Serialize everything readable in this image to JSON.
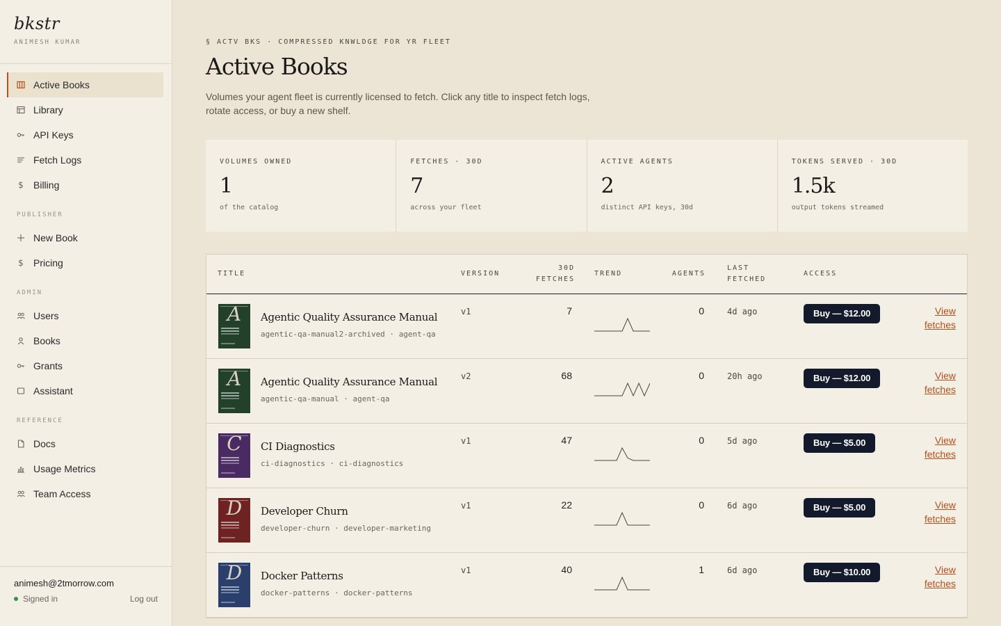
{
  "sidebar": {
    "brand": "bkstr",
    "user": "ANIMESH KUMAR",
    "main_items": [
      {
        "label": "Active Books",
        "icon": "columns-icon"
      },
      {
        "label": "Library",
        "icon": "library-icon"
      },
      {
        "label": "API Keys",
        "icon": "key-icon"
      },
      {
        "label": "Fetch Logs",
        "icon": "list-icon"
      },
      {
        "label": "Billing",
        "icon": "dollar-icon"
      }
    ],
    "publisher_label": "PUBLISHER",
    "publisher_items": [
      {
        "label": "New Book",
        "icon": "plus-icon"
      },
      {
        "label": "Pricing",
        "icon": "dollar-icon"
      }
    ],
    "admin_label": "ADMIN",
    "admin_items": [
      {
        "label": "Users",
        "icon": "users-icon"
      },
      {
        "label": "Books",
        "icon": "person-icon"
      },
      {
        "label": "Grants",
        "icon": "key-icon"
      },
      {
        "label": "Assistant",
        "icon": "square-icon"
      }
    ],
    "reference_label": "REFERENCE",
    "reference_items": [
      {
        "label": "Docs",
        "icon": "document-icon"
      },
      {
        "label": "Usage Metrics",
        "icon": "bar-chart-icon"
      },
      {
        "label": "Team Access",
        "icon": "users-icon"
      }
    ],
    "footer": {
      "email": "animesh@2tmorrow.com",
      "status": "Signed in",
      "logout": "Log out"
    }
  },
  "header": {
    "eyebrow": "§ ACTV BKS · COMPRESSED KNWLDGE FOR YR FLEET",
    "title": "Active Books",
    "description": "Volumes your agent fleet is currently licensed to fetch. Click any title to inspect fetch logs, rotate access, or buy a new shelf."
  },
  "stats": [
    {
      "label": "VOLUMES OWNED",
      "value": "1",
      "sub": "of the catalog"
    },
    {
      "label": "FETCHES · 30D",
      "value": "7",
      "sub": "across your fleet"
    },
    {
      "label": "ACTIVE AGENTS",
      "value": "2",
      "sub": "distinct API keys, 30d"
    },
    {
      "label": "TOKENS SERVED · 30D",
      "value": "1.5k",
      "sub": "output tokens streamed"
    }
  ],
  "table": {
    "columns": {
      "title": "TITLE",
      "version": "VERSION",
      "fetches_1": "30D",
      "fetches_2": "FETCHES",
      "trend": "TREND",
      "agents": "AGENTS",
      "last_1": "LAST",
      "last_2": "FETCHED",
      "access": "ACCESS"
    },
    "rows": [
      {
        "letter": "A",
        "cover_color": "#22402a",
        "title": "Agentic Quality Assurance Manual",
        "slug": "agentic-qa-manual2-archived",
        "tag": "agent-qa",
        "version": "v1",
        "fetches": "7",
        "agents": "0",
        "last": "4d ago",
        "buy": "Buy — $12.00",
        "view": "View fetches",
        "trend": [
          0,
          0,
          0,
          0,
          0,
          0,
          1,
          0,
          0,
          0,
          0
        ]
      },
      {
        "letter": "A",
        "cover_color": "#22402a",
        "title": "Agentic Quality Assurance Manual",
        "slug": "agentic-qa-manual",
        "tag": "agent-qa",
        "version": "v2",
        "fetches": "68",
        "agents": "0",
        "last": "20h ago",
        "buy": "Buy — $12.00",
        "view": "View fetches",
        "trend": [
          0,
          0,
          0,
          0,
          0,
          0,
          1,
          0,
          1,
          0,
          1
        ]
      },
      {
        "letter": "C",
        "cover_color": "#4a2a63",
        "title": "CI Diagnostics",
        "slug": "ci-diagnostics",
        "tag": "ci-diagnostics",
        "version": "v1",
        "fetches": "47",
        "agents": "0",
        "last": "5d ago",
        "buy": "Buy — $5.00",
        "view": "View fetches",
        "trend": [
          0,
          0,
          0,
          0,
          0,
          1,
          0.2,
          0,
          0,
          0,
          0
        ]
      },
      {
        "letter": "D",
        "cover_color": "#6e2222",
        "title": "Developer Churn",
        "slug": "developer-churn",
        "tag": "developer-marketing",
        "version": "v1",
        "fetches": "22",
        "agents": "0",
        "last": "6d ago",
        "buy": "Buy — $5.00",
        "view": "View fetches",
        "trend": [
          0,
          0,
          0,
          0,
          0,
          1,
          0,
          0,
          0,
          0,
          0
        ]
      },
      {
        "letter": "D",
        "cover_color": "#2b3f6d",
        "title": "Docker Patterns",
        "slug": "docker-patterns",
        "tag": "docker-patterns",
        "version": "v1",
        "fetches": "40",
        "agents": "1",
        "last": "6d ago",
        "buy": "Buy — $10.00",
        "view": "View fetches",
        "trend": [
          0,
          0,
          0,
          0,
          0,
          1,
          0,
          0,
          0,
          0,
          0
        ]
      }
    ]
  }
}
